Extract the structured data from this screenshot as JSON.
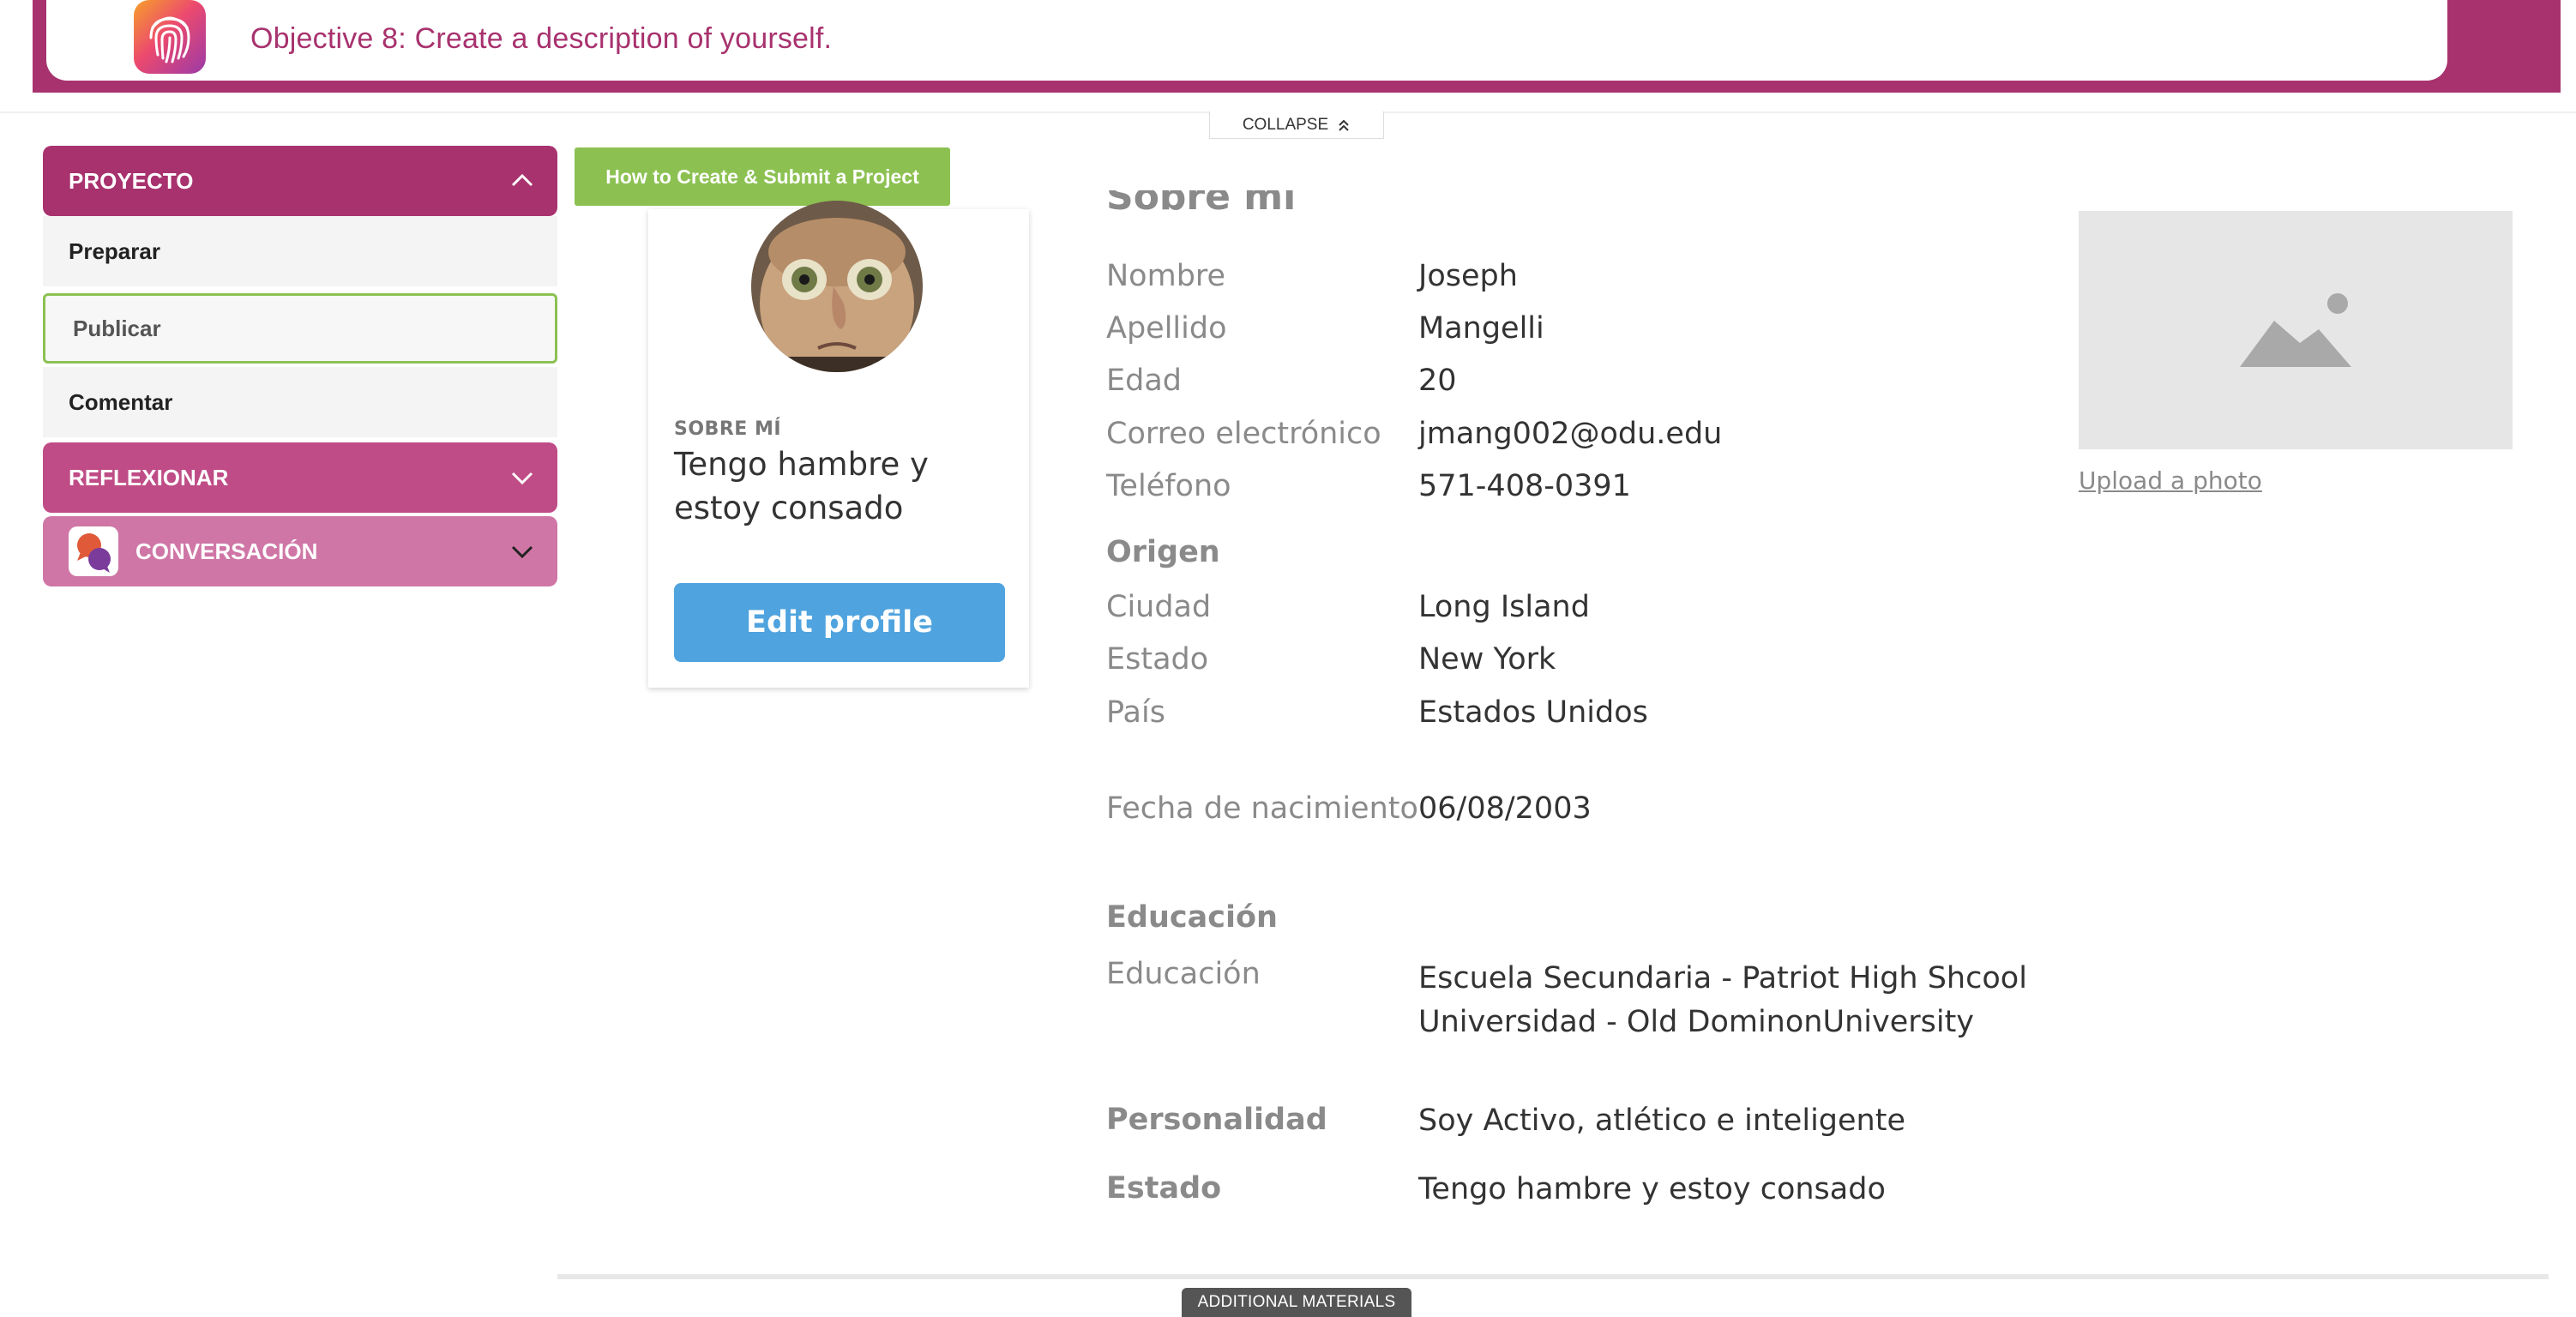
{
  "banner": {
    "title": "Objective 8: Create a description of yourself.",
    "icon": "fingerprint-icon",
    "color": "#a8326e"
  },
  "collapse_label": "COLLAPSE",
  "sidebar": {
    "sections": [
      {
        "label": "PROYECTO",
        "expanded": true,
        "color": "#a8326e",
        "items": [
          {
            "label": "Preparar",
            "active": false
          },
          {
            "label": "Publicar",
            "active": true
          },
          {
            "label": "Comentar",
            "active": false
          }
        ]
      },
      {
        "label": "REFLEXIONAR",
        "expanded": false,
        "color": "#bf4c86"
      },
      {
        "label": "CONVERSACIÓN",
        "expanded": false,
        "color": "#cf76a6",
        "icon": "chat-bubbles-icon"
      }
    ]
  },
  "howto_button": "How to Create & Submit a Project",
  "profile_card": {
    "label": "SOBRE MÍ",
    "status": "Tengo hambre y estoy consado",
    "edit_button": "Edit profile"
  },
  "details": {
    "title": "Sobre mí",
    "rows": [
      {
        "label": "Nombre",
        "value": "Joseph"
      },
      {
        "label": "Apellido",
        "value": "Mangelli"
      },
      {
        "label": "Edad",
        "value": "20"
      },
      {
        "label": "Correo electrónico",
        "value": "jmang002@odu.edu"
      },
      {
        "label": "Teléfono",
        "value": "571-408-0391"
      }
    ],
    "origen": {
      "heading": "Origen",
      "rows": [
        {
          "label": "Ciudad",
          "value": "Long Island"
        },
        {
          "label": "Estado",
          "value": "New York"
        },
        {
          "label": "País",
          "value": "Estados Unidos"
        }
      ]
    },
    "birth": {
      "label": "Fecha de nacimiento",
      "value": "06/08/2003"
    },
    "educacion": {
      "heading": "Educación",
      "label": "Educación",
      "values": [
        "Escuela Secundaria - Patriot High Shcool",
        "Universidad - Old DominonUniversity"
      ]
    },
    "personalidad": {
      "label": "Personalidad",
      "value": "Soy Activo, atlético e inteligente"
    },
    "estado": {
      "label": "Estado",
      "value": "Tengo hambre y estoy consado"
    }
  },
  "photo": {
    "upload_label": "Upload a photo",
    "icon": "image-placeholder-icon"
  },
  "additional_materials": "ADDITIONAL MATERIALS"
}
